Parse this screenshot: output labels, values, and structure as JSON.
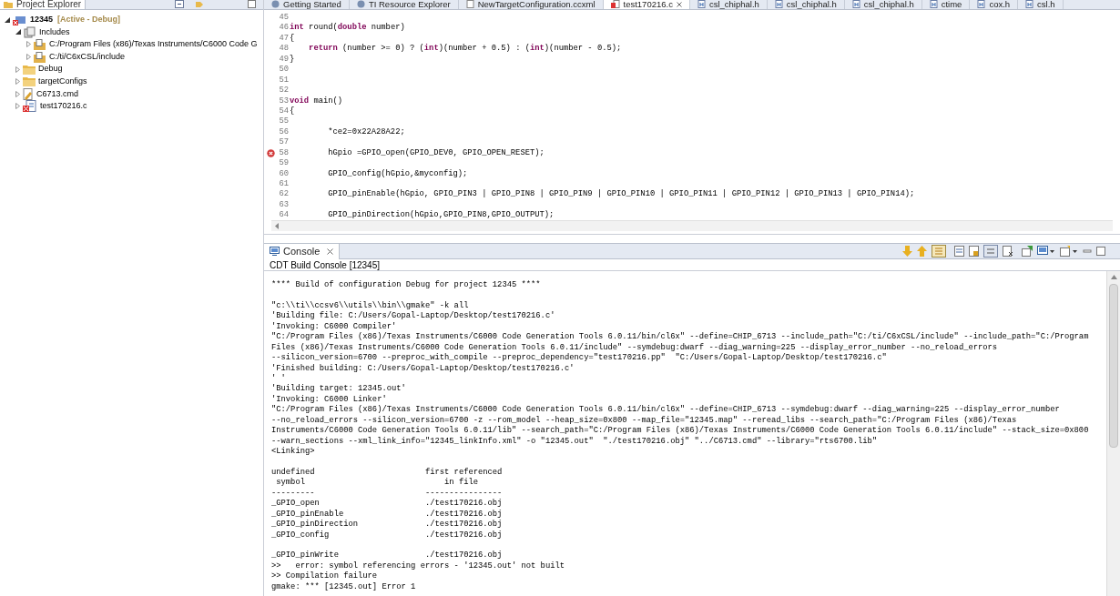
{
  "project_explorer": {
    "title": "Project Explorer",
    "tree": [
      {
        "label": "12345",
        "badge": "[Active - Debug]",
        "kind": "project",
        "expanded": true,
        "children": [
          {
            "label": "Includes",
            "kind": "includes",
            "expanded": true,
            "children": [
              {
                "label": "C:/Program Files (x86)/Texas Instruments/C6000 Code G",
                "kind": "include",
                "expanded": false
              },
              {
                "label": "C:/ti/C6xCSL/include",
                "kind": "include",
                "expanded": false
              }
            ]
          },
          {
            "label": "Debug",
            "kind": "folder",
            "expanded": false
          },
          {
            "label": "targetConfigs",
            "kind": "folder",
            "expanded": false
          },
          {
            "label": "C6713.cmd",
            "kind": "cmd",
            "expanded": false
          },
          {
            "label": "test170216.c",
            "kind": "source-error",
            "expanded": false
          }
        ]
      }
    ]
  },
  "editor": {
    "tabs": [
      {
        "label": "Getting Started",
        "kind": "globe",
        "selected": false
      },
      {
        "label": "TI Resource Explorer",
        "kind": "globe",
        "selected": false
      },
      {
        "label": "NewTargetConfiguration.ccxml",
        "kind": "file",
        "selected": false
      },
      {
        "label": "test170216.c",
        "kind": "error",
        "selected": true
      },
      {
        "label": "csl_chiphal.h",
        "kind": "header",
        "selected": false
      },
      {
        "label": "csl_chiphal.h",
        "kind": "header",
        "selected": false
      },
      {
        "label": "csl_chiphal.h",
        "kind": "header",
        "selected": false
      },
      {
        "label": "ctime",
        "kind": "header",
        "selected": false
      },
      {
        "label": "cox.h",
        "kind": "header",
        "selected": false
      },
      {
        "label": "csl.h",
        "kind": "header",
        "selected": false
      }
    ],
    "lines": [
      {
        "number": "45"
      },
      {
        "number": "46",
        "code": [
          {
            "kind": "keyword",
            "text": "int"
          },
          {
            "kind": "plain",
            "text": " round("
          },
          {
            "kind": "keyword",
            "text": "double"
          },
          {
            "kind": "plain",
            "text": " number)"
          }
        ]
      },
      {
        "number": "47",
        "code": [
          {
            "kind": "plain",
            "text": "{"
          }
        ]
      },
      {
        "number": "48",
        "code": [
          {
            "kind": "keyword",
            "text": "    return"
          },
          {
            "kind": "plain",
            "text": " (number >= 0) ? ("
          },
          {
            "kind": "keyword",
            "text": "int"
          },
          {
            "kind": "plain",
            "text": ")(number + 0.5) : ("
          },
          {
            "kind": "keyword",
            "text": "int"
          },
          {
            "kind": "plain",
            "text": ")(number - 0.5);"
          }
        ]
      },
      {
        "number": "49",
        "code": [
          {
            "kind": "plain",
            "text": "}"
          }
        ]
      },
      {
        "number": "50"
      },
      {
        "number": "51"
      },
      {
        "number": "52"
      },
      {
        "number": "53",
        "code": [
          {
            "kind": "keyword",
            "text": "void"
          },
          {
            "kind": "plain",
            "text": " main()"
          }
        ]
      },
      {
        "number": "54",
        "code": [
          {
            "kind": "plain",
            "text": "{"
          }
        ]
      },
      {
        "number": "55"
      },
      {
        "number": "56",
        "code": [
          {
            "kind": "plain",
            "text": "        *ce2=0x22A28A22;"
          }
        ]
      },
      {
        "number": "57"
      },
      {
        "number": "58",
        "error": true,
        "code": [
          {
            "kind": "plain",
            "text": "        hGpio =GPIO_open(GPIO_DEV0, GPIO_OPEN_RESET);"
          }
        ]
      },
      {
        "number": "59"
      },
      {
        "number": "60",
        "code": [
          {
            "kind": "plain",
            "text": "        GPIO_config(hGpio,&myconfig);"
          }
        ]
      },
      {
        "number": "61"
      },
      {
        "number": "62",
        "code": [
          {
            "kind": "plain",
            "text": "        GPIO_pinEnable(hGpio, GPIO_PIN3 | GPIO_PIN8 | GPIO_PIN9 | GPIO_PIN10 | GPIO_PIN11 | GPIO_PIN12 | GPIO_PIN13 | GPIO_PIN14);"
          }
        ]
      },
      {
        "number": "63"
      },
      {
        "number": "64",
        "code": [
          {
            "kind": "plain",
            "text": "        GPIO_pinDirection(hGpio,GPIO_PIN8,GPIO_OUTPUT);"
          }
        ]
      }
    ]
  },
  "console": {
    "title": "Console",
    "subtitle": "CDT Build Console [12345]",
    "lines": [
      "**** Build of configuration Debug for project 12345 ****",
      {
        "text": "\"c:\\\\ti\\\\ccsv6\\\\utils\\\\bin\\\\gmake\" -k all",
        "blank_before": true
      },
      "'Building file: C:/Users/Gopal-Laptop/Desktop/test170216.c'",
      "'Invoking: C6000 Compiler'",
      "\"C:/Program Files (x86)/Texas Instruments/C6000 Code Generation Tools 6.0.11/bin/cl6x\" --define=CHIP_6713 --include_path=\"C:/ti/C6xCSL/include\" --include_path=\"C:/Program",
      "Files (x86)/Texas Instruments/C6000 Code Generation Tools 6.0.11/include\" --symdebug:dwarf --diag_warning=225 --display_error_number --no_reload_errors",
      "--silicon_version=6700 --preproc_with_compile --preproc_dependency=\"test170216.pp\"  \"C:/Users/Gopal-Laptop/Desktop/test170216.c\"",
      "'Finished building: C:/Users/Gopal-Laptop/Desktop/test170216.c'",
      "' '",
      "'Building target: 12345.out'",
      "'Invoking: C6000 Linker'",
      "\"C:/Program Files (x86)/Texas Instruments/C6000 Code Generation Tools 6.0.11/bin/cl6x\" --define=CHIP_6713 --symdebug:dwarf --diag_warning=225 --display_error_number",
      "--no_reload_errors --silicon_version=6700 -z --rom_model --heap_size=0x800 --map_file=\"12345.map\" --reread_libs --search_path=\"C:/Program Files (x86)/Texas",
      "Instruments/C6000 Code Generation Tools 6.0.11/lib\" --search_path=\"C:/Program Files (x86)/Texas Instruments/C6000 Code Generation Tools 6.0.11/include\" --stack_size=0x800",
      "--warn_sections --xml_link_info=\"12345_linkInfo.xml\" -o \"12345.out\"  \"./test170216.obj\" \"../C6713.cmd\" --library=\"rts6700.lib\"",
      "<Linking>",
      {
        "text": "undefined                       first referenced",
        "blank_before": true
      },
      " symbol                             in file",
      "---------                       ----------------",
      "_GPIO_open                      ./test170216.obj",
      "_GPIO_pinEnable                 ./test170216.obj",
      "_GPIO_pinDirection              ./test170216.obj",
      "_GPIO_config                    ./test170216.obj",
      {
        "text": "_GPIO_pinWrite                  ./test170216.obj",
        "blank_before": true
      },
      ">>   error: symbol referencing errors - '12345.out' not built",
      ">> Compilation failure",
      "gmake: *** [12345.out] Error 1"
    ]
  }
}
